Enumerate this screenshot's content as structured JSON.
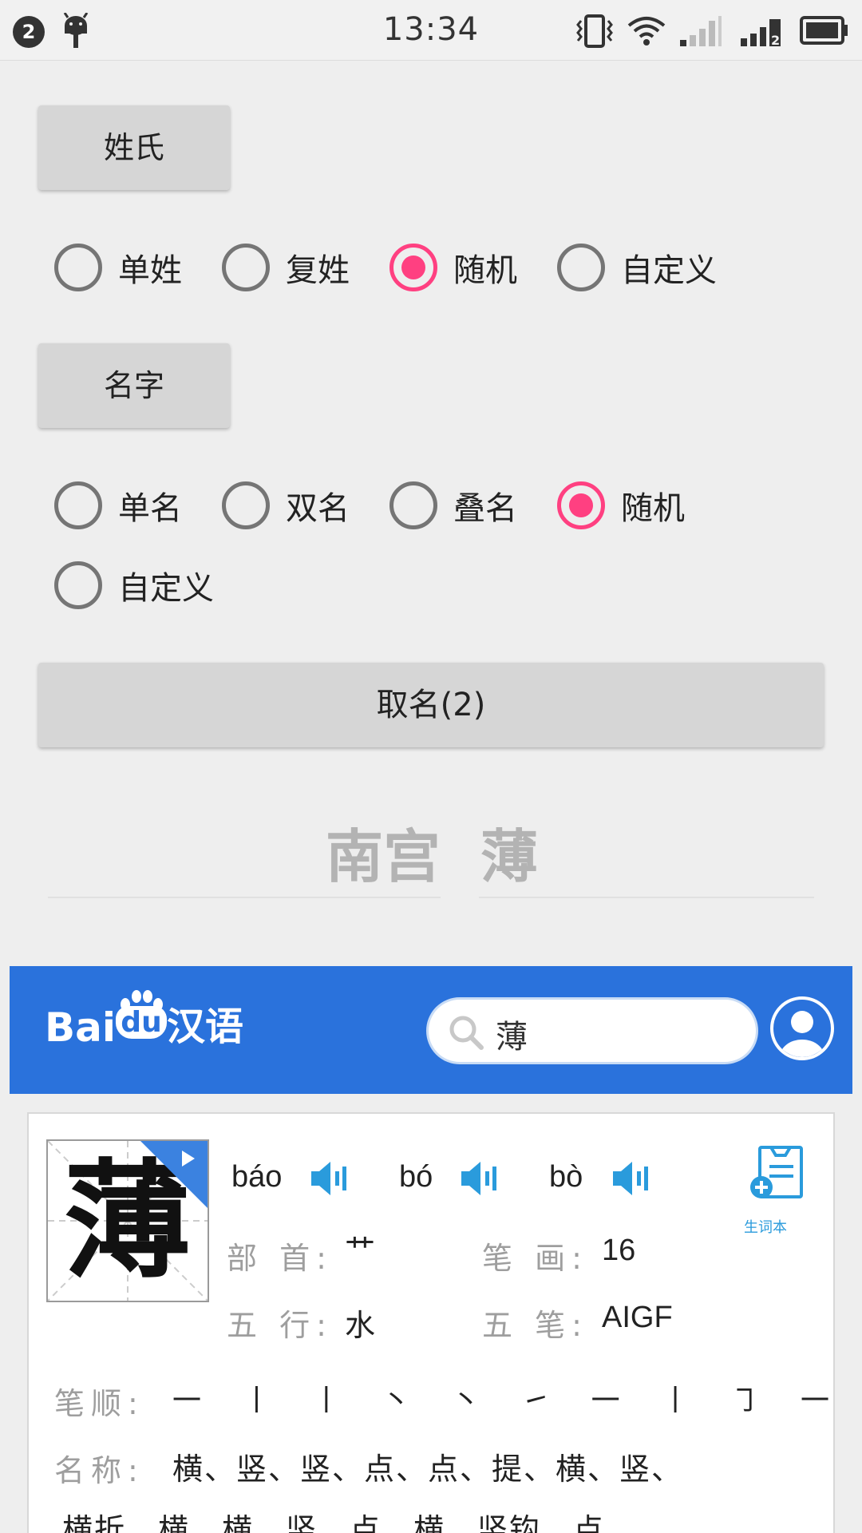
{
  "status_bar": {
    "notification_count": "2",
    "time": "13:34",
    "icons": [
      "android-icon",
      "vibrate-icon",
      "wifi-icon",
      "signal-icon",
      "signal-2-icon",
      "battery-icon"
    ]
  },
  "surname": {
    "button_label": "姓氏",
    "options": [
      {
        "label": "单姓",
        "checked": false
      },
      {
        "label": "复姓",
        "checked": false
      },
      {
        "label": "随机",
        "checked": true
      },
      {
        "label": "自定义",
        "checked": false
      }
    ]
  },
  "given_name": {
    "button_label": "名字",
    "options": [
      {
        "label": "单名",
        "checked": false
      },
      {
        "label": "双名",
        "checked": false
      },
      {
        "label": "叠名",
        "checked": false
      },
      {
        "label": "随机",
        "checked": true
      },
      {
        "label": "自定义",
        "checked": false
      }
    ]
  },
  "generate_button": {
    "label": "取名(2)"
  },
  "result": {
    "surname": "南宫",
    "given": "薄"
  },
  "baidu": {
    "logo_text_bai": "Bai",
    "logo_text_du": "du",
    "logo_text_hanyu": "汉语",
    "search_value": "薄",
    "character": "薄",
    "pinyin": [
      "báo",
      "bó",
      "bò"
    ],
    "wordbook_label": "生词本",
    "radical_label": "部 首:",
    "radical_value": "艹",
    "strokes_label": "笔 画:",
    "strokes_value": "16",
    "wuxing_label": "五 行:",
    "wuxing_value": "水",
    "wubi_label": "五 笔:",
    "wubi_value": "AIGF",
    "stroke_order_label": "笔顺:",
    "stroke_order_value": "一 丨 丨 丶 丶 ㇀ 一 丨 ㇆ 一 一 …",
    "stroke_names_label": "名称:",
    "stroke_names_value": "横、竖、竖、点、点、提、横、竖、",
    "stroke_names_value_2": "横折、横、横、竖、点、横、竖钩、点"
  },
  "colors": {
    "accent": "#ff4081",
    "baidu_blue": "#2a72dc",
    "speaker_blue": "#2a9bdc"
  }
}
